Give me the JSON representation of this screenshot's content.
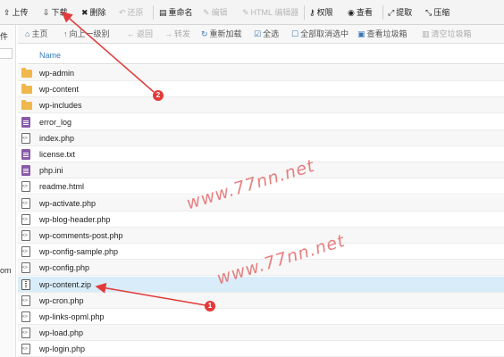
{
  "toolbar": {
    "items": [
      {
        "label": "上传",
        "icon": "upload-icon",
        "glyph": "⇪",
        "disabled": false
      },
      {
        "label": "下载",
        "icon": "download-icon",
        "glyph": "⇩",
        "disabled": false
      },
      {
        "label": "删除",
        "icon": "delete-icon",
        "glyph": "✖",
        "disabled": false
      },
      {
        "label": "还原",
        "icon": "restore-icon",
        "glyph": "↶",
        "disabled": true
      },
      {
        "label": "重命名",
        "icon": "rename-icon",
        "glyph": "▤",
        "disabled": false
      },
      {
        "label": "编辑",
        "icon": "edit-icon",
        "glyph": "✎",
        "disabled": true
      },
      {
        "label": "HTML 编辑器",
        "icon": "html-editor-icon",
        "glyph": "✎",
        "disabled": true
      },
      {
        "label": "权限",
        "icon": "key-icon",
        "glyph": "⚷",
        "disabled": false
      },
      {
        "label": "查看",
        "icon": "eye-icon",
        "glyph": "◉",
        "disabled": false
      },
      {
        "label": "提取",
        "icon": "extract-icon",
        "glyph": "⤢",
        "disabled": false
      },
      {
        "label": "压缩",
        "icon": "compress-icon",
        "glyph": "⤡",
        "disabled": false
      }
    ]
  },
  "sidebar": {
    "fragments": [
      "件",
      "om"
    ]
  },
  "navbar": {
    "items": [
      {
        "label": "主页",
        "icon": "home-icon",
        "glyph": "⌂",
        "dim": false
      },
      {
        "label": "向上一级别",
        "icon": "level-up-icon",
        "glyph": "↑",
        "dim": false
      },
      {
        "label": "返回",
        "icon": "back-icon",
        "glyph": "←",
        "dim": true
      },
      {
        "label": "转发",
        "icon": "forward-icon",
        "glyph": "→",
        "dim": true
      },
      {
        "label": "重新加载",
        "icon": "reload-icon",
        "glyph": "↻",
        "dim": false
      },
      {
        "label": "全选",
        "icon": "select-all-icon",
        "glyph": "☑",
        "dim": false
      },
      {
        "label": "全部取消选中",
        "icon": "unselect-all-icon",
        "glyph": "☐",
        "dim": false
      },
      {
        "label": "查看垃圾箱",
        "icon": "trash-view-icon",
        "glyph": "▣",
        "dim": false
      },
      {
        "label": "清空垃圾箱",
        "icon": "trash-empty-icon",
        "glyph": "▥",
        "dim": true
      }
    ]
  },
  "table": {
    "header": "Name",
    "files": [
      {
        "name": "wp-admin",
        "type": "folder"
      },
      {
        "name": "wp-content",
        "type": "folder"
      },
      {
        "name": "wp-includes",
        "type": "folder"
      },
      {
        "name": "error_log",
        "type": "text"
      },
      {
        "name": "index.php",
        "type": "code"
      },
      {
        "name": "license.txt",
        "type": "text"
      },
      {
        "name": "php.ini",
        "type": "text"
      },
      {
        "name": "readme.html",
        "type": "code"
      },
      {
        "name": "wp-activate.php",
        "type": "code"
      },
      {
        "name": "wp-blog-header.php",
        "type": "code"
      },
      {
        "name": "wp-comments-post.php",
        "type": "code"
      },
      {
        "name": "wp-config-sample.php",
        "type": "code"
      },
      {
        "name": "wp-config.php",
        "type": "code"
      },
      {
        "name": "wp-content.zip",
        "type": "zip",
        "selected": true
      },
      {
        "name": "wp-cron.php",
        "type": "code"
      },
      {
        "name": "wp-links-opml.php",
        "type": "code"
      },
      {
        "name": "wp-load.php",
        "type": "code"
      },
      {
        "name": "wp-login.php",
        "type": "code"
      }
    ]
  },
  "watermarks": [
    "www.77nn.net",
    "www.77nn.net"
  ],
  "annotations": {
    "badge_1": "1",
    "badge_2": "2",
    "color": "#e23a3a"
  },
  "colors": {
    "accent": "#3a7cc0",
    "folder": "#f0b84a",
    "text_file": "#8a5aa8",
    "selected_row": "#d9ecf9"
  }
}
